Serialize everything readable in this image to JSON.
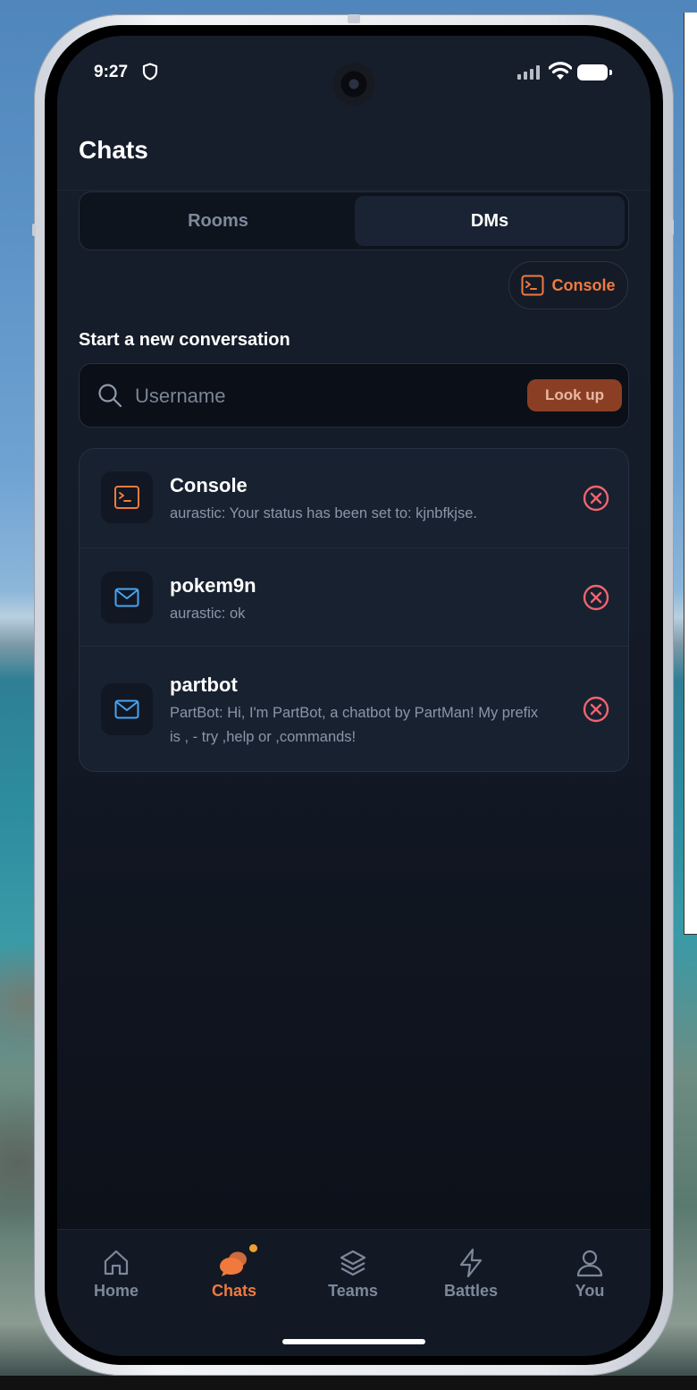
{
  "status_bar": {
    "time": "9:27"
  },
  "header": {
    "title": "Chats"
  },
  "tabs": [
    {
      "label": "Rooms",
      "active": false
    },
    {
      "label": "DMs",
      "active": true
    }
  ],
  "console_chip": {
    "label": "Console"
  },
  "new_conversation": {
    "label": "Start a new conversation",
    "placeholder": "Username",
    "value": "",
    "button": "Look up"
  },
  "conversations": [
    {
      "name": "Console",
      "preview": "aurastic: Your status has been set to: kjnbfkjse.",
      "icon": "terminal-icon"
    },
    {
      "name": "pokem9n",
      "preview": "aurastic: ok",
      "icon": "mail-icon"
    },
    {
      "name": "partbot",
      "preview": "PartBot: Hi, I'm PartBot, a chatbot by PartMan! My prefix is , - try ,help or ,commands!",
      "icon": "mail-icon"
    }
  ],
  "nav": [
    {
      "label": "Home",
      "icon": "home-icon",
      "active": false
    },
    {
      "label": "Chats",
      "icon": "chat-icon",
      "active": true
    },
    {
      "label": "Teams",
      "icon": "layers-icon",
      "active": false
    },
    {
      "label": "Battles",
      "icon": "lightning-icon",
      "active": false
    },
    {
      "label": "You",
      "icon": "user-icon",
      "active": false
    }
  ],
  "colors": {
    "accent": "#f07a3e",
    "close": "#f06470",
    "mail": "#4aa3f0",
    "background": "#0f141e"
  }
}
